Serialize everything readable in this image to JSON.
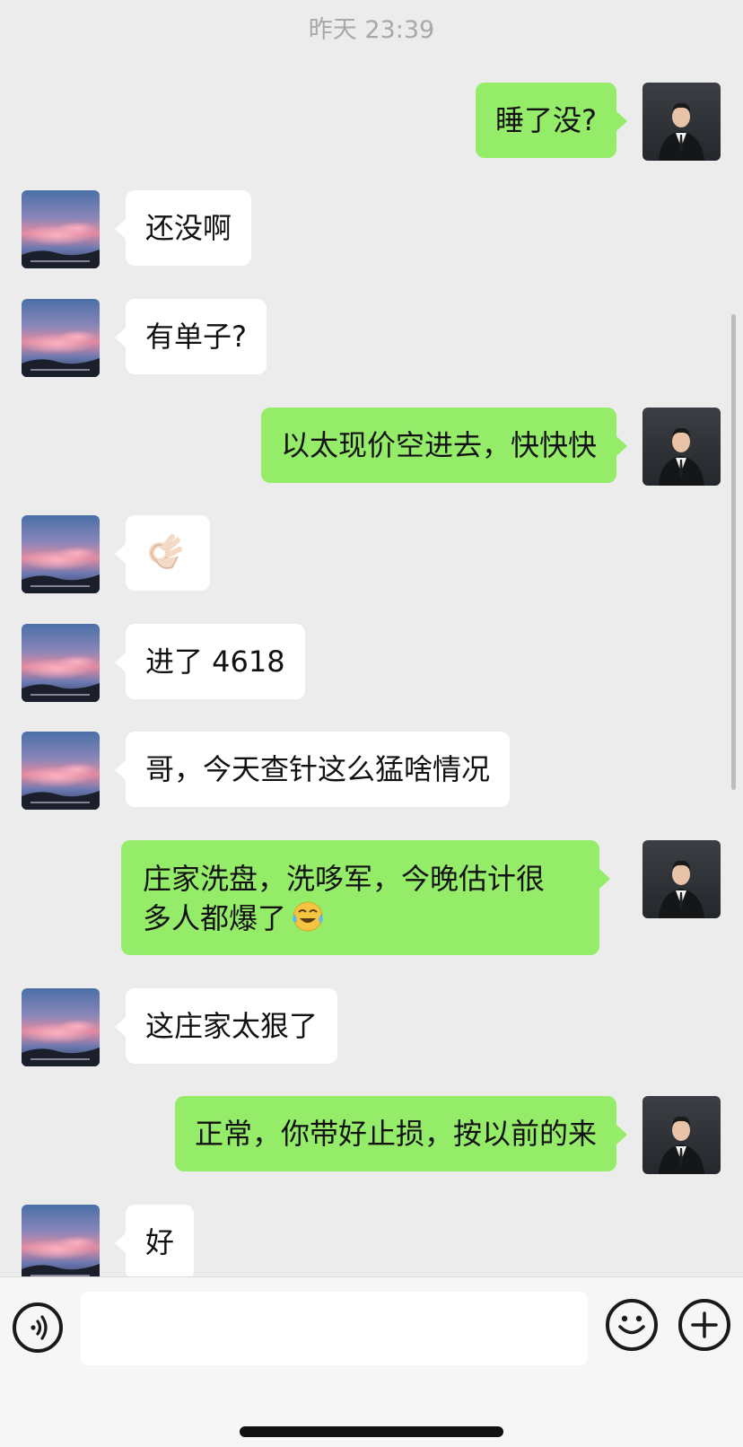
{
  "chat": {
    "timestamp": "昨天 23:39",
    "messages": [
      {
        "side": "out",
        "text": "睡了没?"
      },
      {
        "side": "in",
        "text": "还没啊"
      },
      {
        "side": "in",
        "text": "有单子?"
      },
      {
        "side": "out",
        "text": "以太现价空进去，快快快"
      },
      {
        "side": "in",
        "emoji": "ok-hand-icon"
      },
      {
        "side": "in",
        "text": "进了 4618"
      },
      {
        "side": "in",
        "text": "哥，今天查针这么猛啥情况"
      },
      {
        "side": "out",
        "text_line1": "庄家洗盘，洗哆军，今晚估计很",
        "text_line2": "多人都爆了"
      },
      {
        "side": "in",
        "text": "这庄家太狠了"
      },
      {
        "side": "out",
        "text": "正常，你带好止损，按以前的来"
      },
      {
        "side": "in",
        "text": "好"
      }
    ]
  },
  "icons": {
    "voice": "voice-icon",
    "emoji": "emoji-icon",
    "plus": "plus-icon",
    "ok": "ok-hand-icon",
    "crying_laughing": "crying-laughing-icon"
  },
  "colors": {
    "outgoing_bubble": "#95ec69",
    "incoming_bubble": "#ffffff",
    "background": "#ececec"
  },
  "input": {
    "value": ""
  }
}
